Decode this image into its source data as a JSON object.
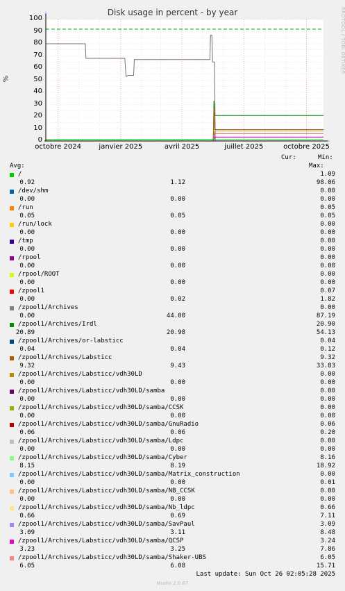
{
  "chart_data": {
    "type": "line",
    "title": "Disk usage in percent - by year",
    "ylabel": "%",
    "side_label": "RRDTOOL / TOBI OETIKER",
    "ylim": [
      0,
      100
    ],
    "yticks": [
      0,
      10,
      20,
      30,
      40,
      50,
      60,
      70,
      80,
      90,
      100
    ],
    "x_range": [
      "2024-09-13",
      "2025-10-26"
    ],
    "xticks": [
      {
        "date": "2024-10-01",
        "label": "octobre 2024"
      },
      {
        "date": "2025-01-01",
        "label": "janvier 2025"
      },
      {
        "date": "2025-04-01",
        "label": "avril 2025"
      },
      {
        "date": "2025-07-01",
        "label": "juillet 2025"
      },
      {
        "date": "2025-10-01",
        "label": "octobre 2025"
      }
    ],
    "grid": true,
    "warning_line": {
      "value": 92,
      "color": "#00aa00"
    },
    "series": [
      {
        "name": "/zpool1/Archives",
        "color": "#7a6e6e",
        "points": [
          [
            "2024-09-13",
            80
          ],
          [
            "2024-11-10",
            80
          ],
          [
            "2024-11-11",
            68
          ],
          [
            "2025-01-07",
            68
          ],
          [
            "2025-01-09",
            53
          ],
          [
            "2025-01-12",
            54
          ],
          [
            "2025-01-20",
            54
          ],
          [
            "2025-01-21",
            67
          ],
          [
            "2025-05-12",
            67
          ],
          [
            "2025-05-13",
            87
          ],
          [
            "2025-05-15",
            87
          ],
          [
            "2025-05-16",
            65
          ],
          [
            "2025-05-19",
            65
          ],
          [
            "2025-05-20",
            0
          ],
          [
            "2025-10-26",
            0
          ]
        ]
      },
      {
        "name": "/zpool1/Archives/Irdl",
        "color": "#008f00",
        "points": [
          [
            "2024-09-13",
            1
          ],
          [
            "2025-05-17",
            1
          ],
          [
            "2025-05-18",
            33
          ],
          [
            "2025-05-19",
            21
          ],
          [
            "2025-10-26",
            21
          ]
        ]
      },
      {
        "name": "/zpool1/Archives/Labsticc",
        "color": "#b35a00",
        "points": [
          [
            "2024-09-13",
            0
          ],
          [
            "2025-05-17",
            0
          ],
          [
            "2025-05-18",
            27
          ],
          [
            "2025-05-19",
            9.4
          ],
          [
            "2025-10-26",
            9.4
          ]
        ]
      },
      {
        "name": "/zpool1/Archives/Labsticc/vdh30LD/samba/Cyber",
        "color": "#a0a040",
        "points": [
          [
            "2024-09-13",
            0
          ],
          [
            "2025-05-17",
            0
          ],
          [
            "2025-05-19",
            8.2
          ],
          [
            "2025-10-26",
            8.2
          ]
        ]
      },
      {
        "name": "/zpool1/Archives/Labsticc/vdh30LD/samba/Shaker-UBS",
        "color": "#cc6666",
        "points": [
          [
            "2024-09-13",
            0
          ],
          [
            "2025-05-17",
            0
          ],
          [
            "2025-05-19",
            6.1
          ],
          [
            "2025-10-26",
            6.1
          ]
        ]
      },
      {
        "name": "/zpool1/Archives/Labsticc/vdh30LD/samba/SavPaul",
        "color": "#7b68ee",
        "points": [
          [
            "2024-09-13",
            0
          ],
          [
            "2025-05-17",
            0
          ],
          [
            "2025-05-19",
            3.1
          ],
          [
            "2025-10-26",
            3.1
          ]
        ]
      },
      {
        "name": "/zpool1/Archives/Labsticc/vdh30LD/samba/QCSP",
        "color": "#cc00cc",
        "points": [
          [
            "2024-09-13",
            0
          ],
          [
            "2025-05-17",
            0
          ],
          [
            "2025-05-19",
            3.2
          ],
          [
            "2025-10-26",
            3.2
          ]
        ]
      },
      {
        "name": "/",
        "color": "#00cc00",
        "points": [
          [
            "2024-09-13",
            1
          ],
          [
            "2025-10-26",
            1
          ]
        ]
      }
    ]
  },
  "legend": {
    "header_cur": "Cur:",
    "header_min": "Min:",
    "header_avg": "Avg:",
    "header_max": "Max:",
    "rows": [
      {
        "color": "#00cc00",
        "label": "/",
        "cur": "0.92",
        "min": "1.12",
        "avg": "1.09",
        "max": "98.06"
      },
      {
        "color": "#0066b3",
        "label": "/dev/shm",
        "cur": "0.00",
        "min": "0.00",
        "avg": "0.00",
        "max": "0.00"
      },
      {
        "color": "#ff8000",
        "label": "/run",
        "cur": "0.05",
        "min": "0.05",
        "avg": "0.05",
        "max": "0.05"
      },
      {
        "color": "#ffcc00",
        "label": "/run/lock",
        "cur": "0.00",
        "min": "0.00",
        "avg": "0.00",
        "max": "0.00"
      },
      {
        "color": "#330099",
        "label": "/tmp",
        "cur": "0.00",
        "min": "0.00",
        "avg": "0.00",
        "max": "0.00"
      },
      {
        "color": "#990099",
        "label": "/rpool",
        "cur": "0.00",
        "min": "0.00",
        "avg": "0.00",
        "max": "0.00"
      },
      {
        "color": "#ccff00",
        "label": "/rpool/ROOT",
        "cur": "0.00",
        "min": "0.00",
        "avg": "0.00",
        "max": "0.00"
      },
      {
        "color": "#ff0000",
        "label": "/zpool1",
        "cur": "0.00",
        "min": "0.02",
        "avg": "0.07",
        "max": "1.82"
      },
      {
        "color": "#808080",
        "label": "/zpool1/Archives",
        "cur": "0.00",
        "min": "44.00",
        "avg": "0.00",
        "max": "87.19"
      },
      {
        "color": "#008f00",
        "label": "/zpool1/Archives/Irdl",
        "cur": "20.89",
        "min": "20.98",
        "avg": "20.90",
        "max": "54.13"
      },
      {
        "color": "#00487d",
        "label": "/zpool1/Archives/or-labsticc",
        "cur": "0.04",
        "min": "0.04",
        "avg": "0.04",
        "max": "0.12"
      },
      {
        "color": "#b35a00",
        "label": "/zpool1/Archives/Labsticc",
        "cur": "9.32",
        "min": "9.43",
        "avg": "9.32",
        "max": "33.83"
      },
      {
        "color": "#b38f00",
        "label": "/zpool1/Archives/Labsticc/vdh30LD",
        "cur": "0.00",
        "min": "0.00",
        "avg": "0.00",
        "max": "0.00"
      },
      {
        "color": "#6b006b",
        "label": "/zpool1/Archives/Labsticc/vdh30LD/samba",
        "cur": "0.00",
        "min": "0.00",
        "avg": "0.00",
        "max": "0.00"
      },
      {
        "color": "#8fb300",
        "label": "/zpool1/Archives/Labsticc/vdh30LD/samba/CCSK",
        "cur": "0.00",
        "min": "0.00",
        "avg": "0.00",
        "max": "0.00"
      },
      {
        "color": "#b30000",
        "label": "/zpool1/Archives/Labsticc/vdh30LD/samba/GnuRadio",
        "cur": "0.06",
        "min": "0.06",
        "avg": "0.06",
        "max": "0.20"
      },
      {
        "color": "#bebebe",
        "label": "/zpool1/Archives/Labsticc/vdh30LD/samba/Ldpc",
        "cur": "0.00",
        "min": "0.00",
        "avg": "0.00",
        "max": "0.00"
      },
      {
        "color": "#80ff80",
        "label": "/zpool1/Archives/Labsticc/vdh30LD/samba/Cyber",
        "cur": "8.15",
        "min": "8.19",
        "avg": "8.16",
        "max": "18.92"
      },
      {
        "color": "#80c9ff",
        "label": "/zpool1/Archives/Labsticc/vdh30LD/samba/Matrix_construction",
        "cur": "0.00",
        "min": "0.00",
        "avg": "0.00",
        "max": "0.01"
      },
      {
        "color": "#ffc080",
        "label": "/zpool1/Archives/Labsticc/vdh30LD/samba/NB_CCSK",
        "cur": "0.00",
        "min": "0.00",
        "avg": "0.00",
        "max": "0.00"
      },
      {
        "color": "#ffe680",
        "label": "/zpool1/Archives/Labsticc/vdh30LD/samba/Nb_ldpc",
        "cur": "0.66",
        "min": "0.69",
        "avg": "0.66",
        "max": "7.11"
      },
      {
        "color": "#aa80ff",
        "label": "/zpool1/Archives/Labsticc/vdh30LD/samba/SavPaul",
        "cur": "3.09",
        "min": "3.11",
        "avg": "3.09",
        "max": "8.48"
      },
      {
        "color": "#ee00cc",
        "label": "/zpool1/Archives/Labsticc/vdh30LD/samba/QCSP",
        "cur": "3.23",
        "min": "3.25",
        "avg": "3.24",
        "max": "7.86"
      },
      {
        "color": "#ff8080",
        "label": "/zpool1/Archives/Labsticc/vdh30LD/samba/Shaker-UBS",
        "cur": "6.05",
        "min": "6.08",
        "avg": "6.05",
        "max": "15.71"
      }
    ]
  },
  "footer": {
    "last_update": "Last update: Sun Oct 26 02:05:28 2025",
    "munin": "Munin 2.0.67"
  }
}
